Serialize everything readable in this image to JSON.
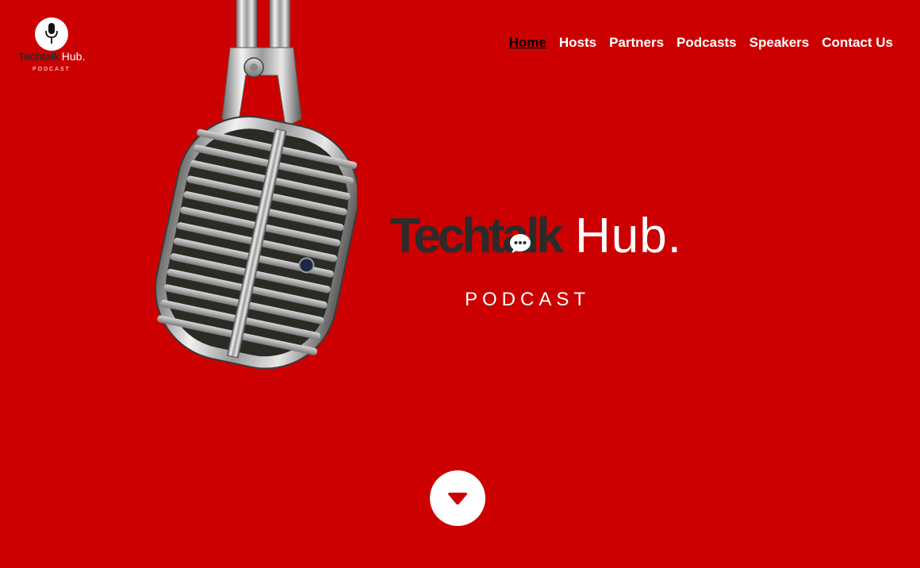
{
  "site": {
    "logo": {
      "brand_dark": "Techtalk",
      "brand_light": "Hub.",
      "subtitle": "PODCAST"
    }
  },
  "nav": {
    "items": [
      {
        "label": "Home",
        "active": true
      },
      {
        "label": "Hosts",
        "active": false
      },
      {
        "label": "Partners",
        "active": false
      },
      {
        "label": "Podcasts",
        "active": false
      },
      {
        "label": "Speakers",
        "active": false
      },
      {
        "label": "Contact Us",
        "active": false
      }
    ]
  },
  "hero": {
    "brand_dark": "Techtalk",
    "brand_light": "Hub.",
    "subtitle": "PODCAST",
    "image": "vintage-microphone-illustration"
  },
  "scroll_button": {
    "icon": "chevron-down-icon"
  },
  "colors": {
    "background": "#cc0000",
    "accent_dark": "#2b2b2b",
    "text_light": "#ffffff",
    "nav_active": "#000000"
  }
}
